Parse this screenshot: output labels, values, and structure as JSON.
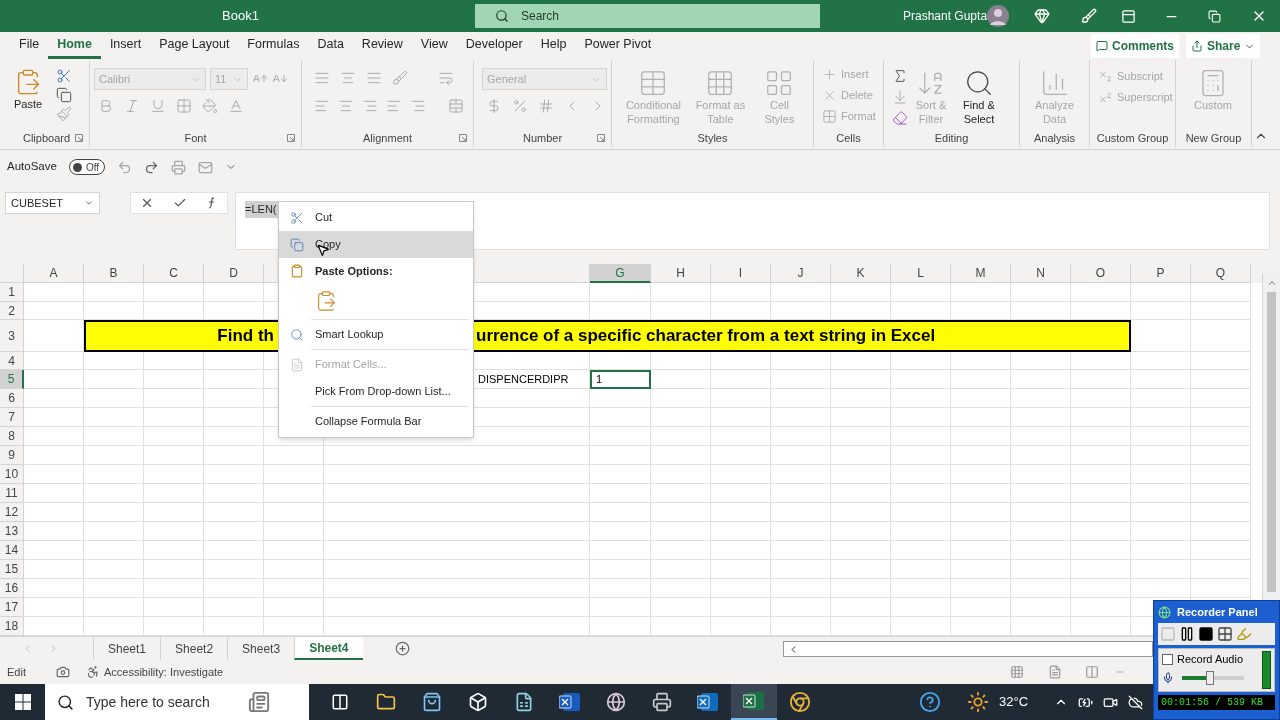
{
  "title_bar": {
    "title": "Book1",
    "search": "Search",
    "user": "Prashant Gupta"
  },
  "menu_tabs": [
    {
      "label": "File",
      "selected": false
    },
    {
      "label": "Home",
      "selected": true
    },
    {
      "label": "Insert",
      "selected": false
    },
    {
      "label": "Page Layout",
      "selected": false
    },
    {
      "label": "Formulas",
      "selected": false
    },
    {
      "label": "Data",
      "selected": false
    },
    {
      "label": "Review",
      "selected": false
    },
    {
      "label": "View",
      "selected": false
    },
    {
      "label": "Developer",
      "selected": false
    },
    {
      "label": "Help",
      "selected": false
    },
    {
      "label": "Power Pivot",
      "selected": false
    }
  ],
  "comments": "Comments",
  "share": "Share",
  "ribbon": {
    "clipboard": {
      "label": "Clipboard",
      "paste": "Paste"
    },
    "font": {
      "label": "Font",
      "font_name": {
        "value": "Calibri",
        "disabled": true
      },
      "font_size": {
        "value": "11",
        "disabled": true
      }
    },
    "alignment": {
      "label": "Alignment"
    },
    "number": {
      "label": "Number",
      "format": {
        "value": "General",
        "disabled": true
      }
    },
    "styles": {
      "label": "Styles",
      "buttons": [
        {
          "lines": [
            "Conditional",
            "Formatting"
          ],
          "disabled": true
        },
        {
          "lines": [
            "Format as",
            "Table"
          ],
          "disabled": true
        },
        {
          "lines": [
            "Cell",
            "Styles"
          ],
          "disabled": true
        }
      ]
    },
    "cells": {
      "label": "Cells",
      "buttons": [
        {
          "label": "Insert",
          "disabled": true
        },
        {
          "label": "Delete",
          "disabled": true
        },
        {
          "label": "Format",
          "disabled": true
        }
      ]
    },
    "editing": {
      "label": "Editing",
      "buttons": [
        {
          "lines": [
            "Sort &",
            "Filter"
          ],
          "disabled": true
        },
        {
          "lines": [
            "Find &",
            "Select"
          ],
          "disabled": false
        }
      ]
    },
    "analysis": {
      "label": "Analysis",
      "button": {
        "lines": [
          "Analyze",
          "Data"
        ],
        "disabled": true
      }
    },
    "custom_group": {
      "label": "Custom Group",
      "buttons": [
        {
          "label": "Subscript",
          "disabled": true
        },
        {
          "label": "Superscript",
          "disabled": true
        }
      ]
    },
    "new_group": {
      "label": "New Group",
      "button": {
        "label": "Custom",
        "disabled": true
      }
    }
  },
  "quick_access": {
    "autosave": {
      "label": "AutoSave",
      "state": "Off",
      "on": false
    }
  },
  "formula_bar": {
    "name_box": "CUBESET",
    "formula": "=LEN("
  },
  "columns": [
    {
      "letter": "A",
      "selected": false
    },
    {
      "letter": "B",
      "selected": false
    },
    {
      "letter": "C",
      "selected": false
    },
    {
      "letter": "D",
      "selected": false
    },
    {
      "selected": false
    },
    {
      "selected": false
    },
    {
      "letter": "G",
      "selected": true
    },
    {
      "letter": "H",
      "selected": false
    },
    {
      "letter": "I",
      "selected": false
    },
    {
      "letter": "J",
      "selected": false
    },
    {
      "letter": "K",
      "selected": false
    },
    {
      "letter": "L",
      "selected": false
    },
    {
      "letter": "M",
      "selected": false
    },
    {
      "letter": "N",
      "selected": false
    },
    {
      "letter": "O",
      "selected": false
    },
    {
      "letter": "P",
      "selected": false
    },
    {
      "letter": "Q",
      "selected": false
    }
  ],
  "rows": [
    {
      "number": "1",
      "selected": false
    },
    {
      "number": "2",
      "selected": false
    },
    {
      "number": "3",
      "selected": false
    },
    {
      "number": "4",
      "selected": false
    },
    {
      "number": "5",
      "selected": true
    },
    {
      "number": "6",
      "selected": false
    },
    {
      "number": "7",
      "selected": false
    },
    {
      "number": "8",
      "selected": false
    },
    {
      "number": "9",
      "selected": false
    },
    {
      "number": "10",
      "selected": false
    },
    {
      "number": "11",
      "selected": false
    },
    {
      "number": "12",
      "selected": false
    },
    {
      "number": "13",
      "selected": false
    },
    {
      "number": "14",
      "selected": false
    },
    {
      "number": "15",
      "selected": false
    },
    {
      "number": "16",
      "selected": false
    },
    {
      "number": "17",
      "selected": false
    },
    {
      "number": "18",
      "selected": false
    }
  ],
  "cells": {
    "banner_parts": [
      "Find th",
      "urrence of a specific character from a text string in Excel"
    ],
    "f5": "DISPENCERDIPR",
    "g5": {
      "value": "1",
      "selected": true
    }
  },
  "context_menu": [
    {
      "kind": "item",
      "label": "Cut",
      "highlighted": false,
      "disabled": false
    },
    {
      "kind": "item",
      "label": "Copy",
      "highlighted": true,
      "disabled": false
    },
    {
      "kind": "header",
      "label": "Paste Options:"
    },
    {
      "kind": "paste_icons"
    },
    {
      "kind": "separator"
    },
    {
      "kind": "item",
      "label": "Smart Lookup",
      "highlighted": false,
      "disabled": false
    },
    {
      "kind": "separator"
    },
    {
      "kind": "item",
      "label": "Format Cells...",
      "highlighted": false,
      "disabled": true
    },
    {
      "kind": "item",
      "label": "Pick From Drop-down List...",
      "highlighted": false,
      "disabled": false
    },
    {
      "kind": "separator"
    },
    {
      "kind": "item",
      "label": "Collapse Formula Bar",
      "highlighted": false,
      "disabled": false
    }
  ],
  "sheet_tabs": [
    {
      "label": "Sheet1",
      "selected": false
    },
    {
      "label": "Sheet2",
      "selected": false
    },
    {
      "label": "Sheet3",
      "selected": false
    },
    {
      "label": "Sheet4",
      "selected": true
    }
  ],
  "status_bar": {
    "mode": "Edit",
    "accessibility": "Accessibility: Investigate"
  },
  "taskbar": {
    "search_placeholder": "Type here to search",
    "weather": "32°C"
  },
  "recorder_panel": {
    "title": "Recorder Panel",
    "record_audio": {
      "label": "Record Audio",
      "checked": false
    },
    "volume": {
      "level": 0.45
    },
    "time": "00:01:56 / 539 KB"
  }
}
